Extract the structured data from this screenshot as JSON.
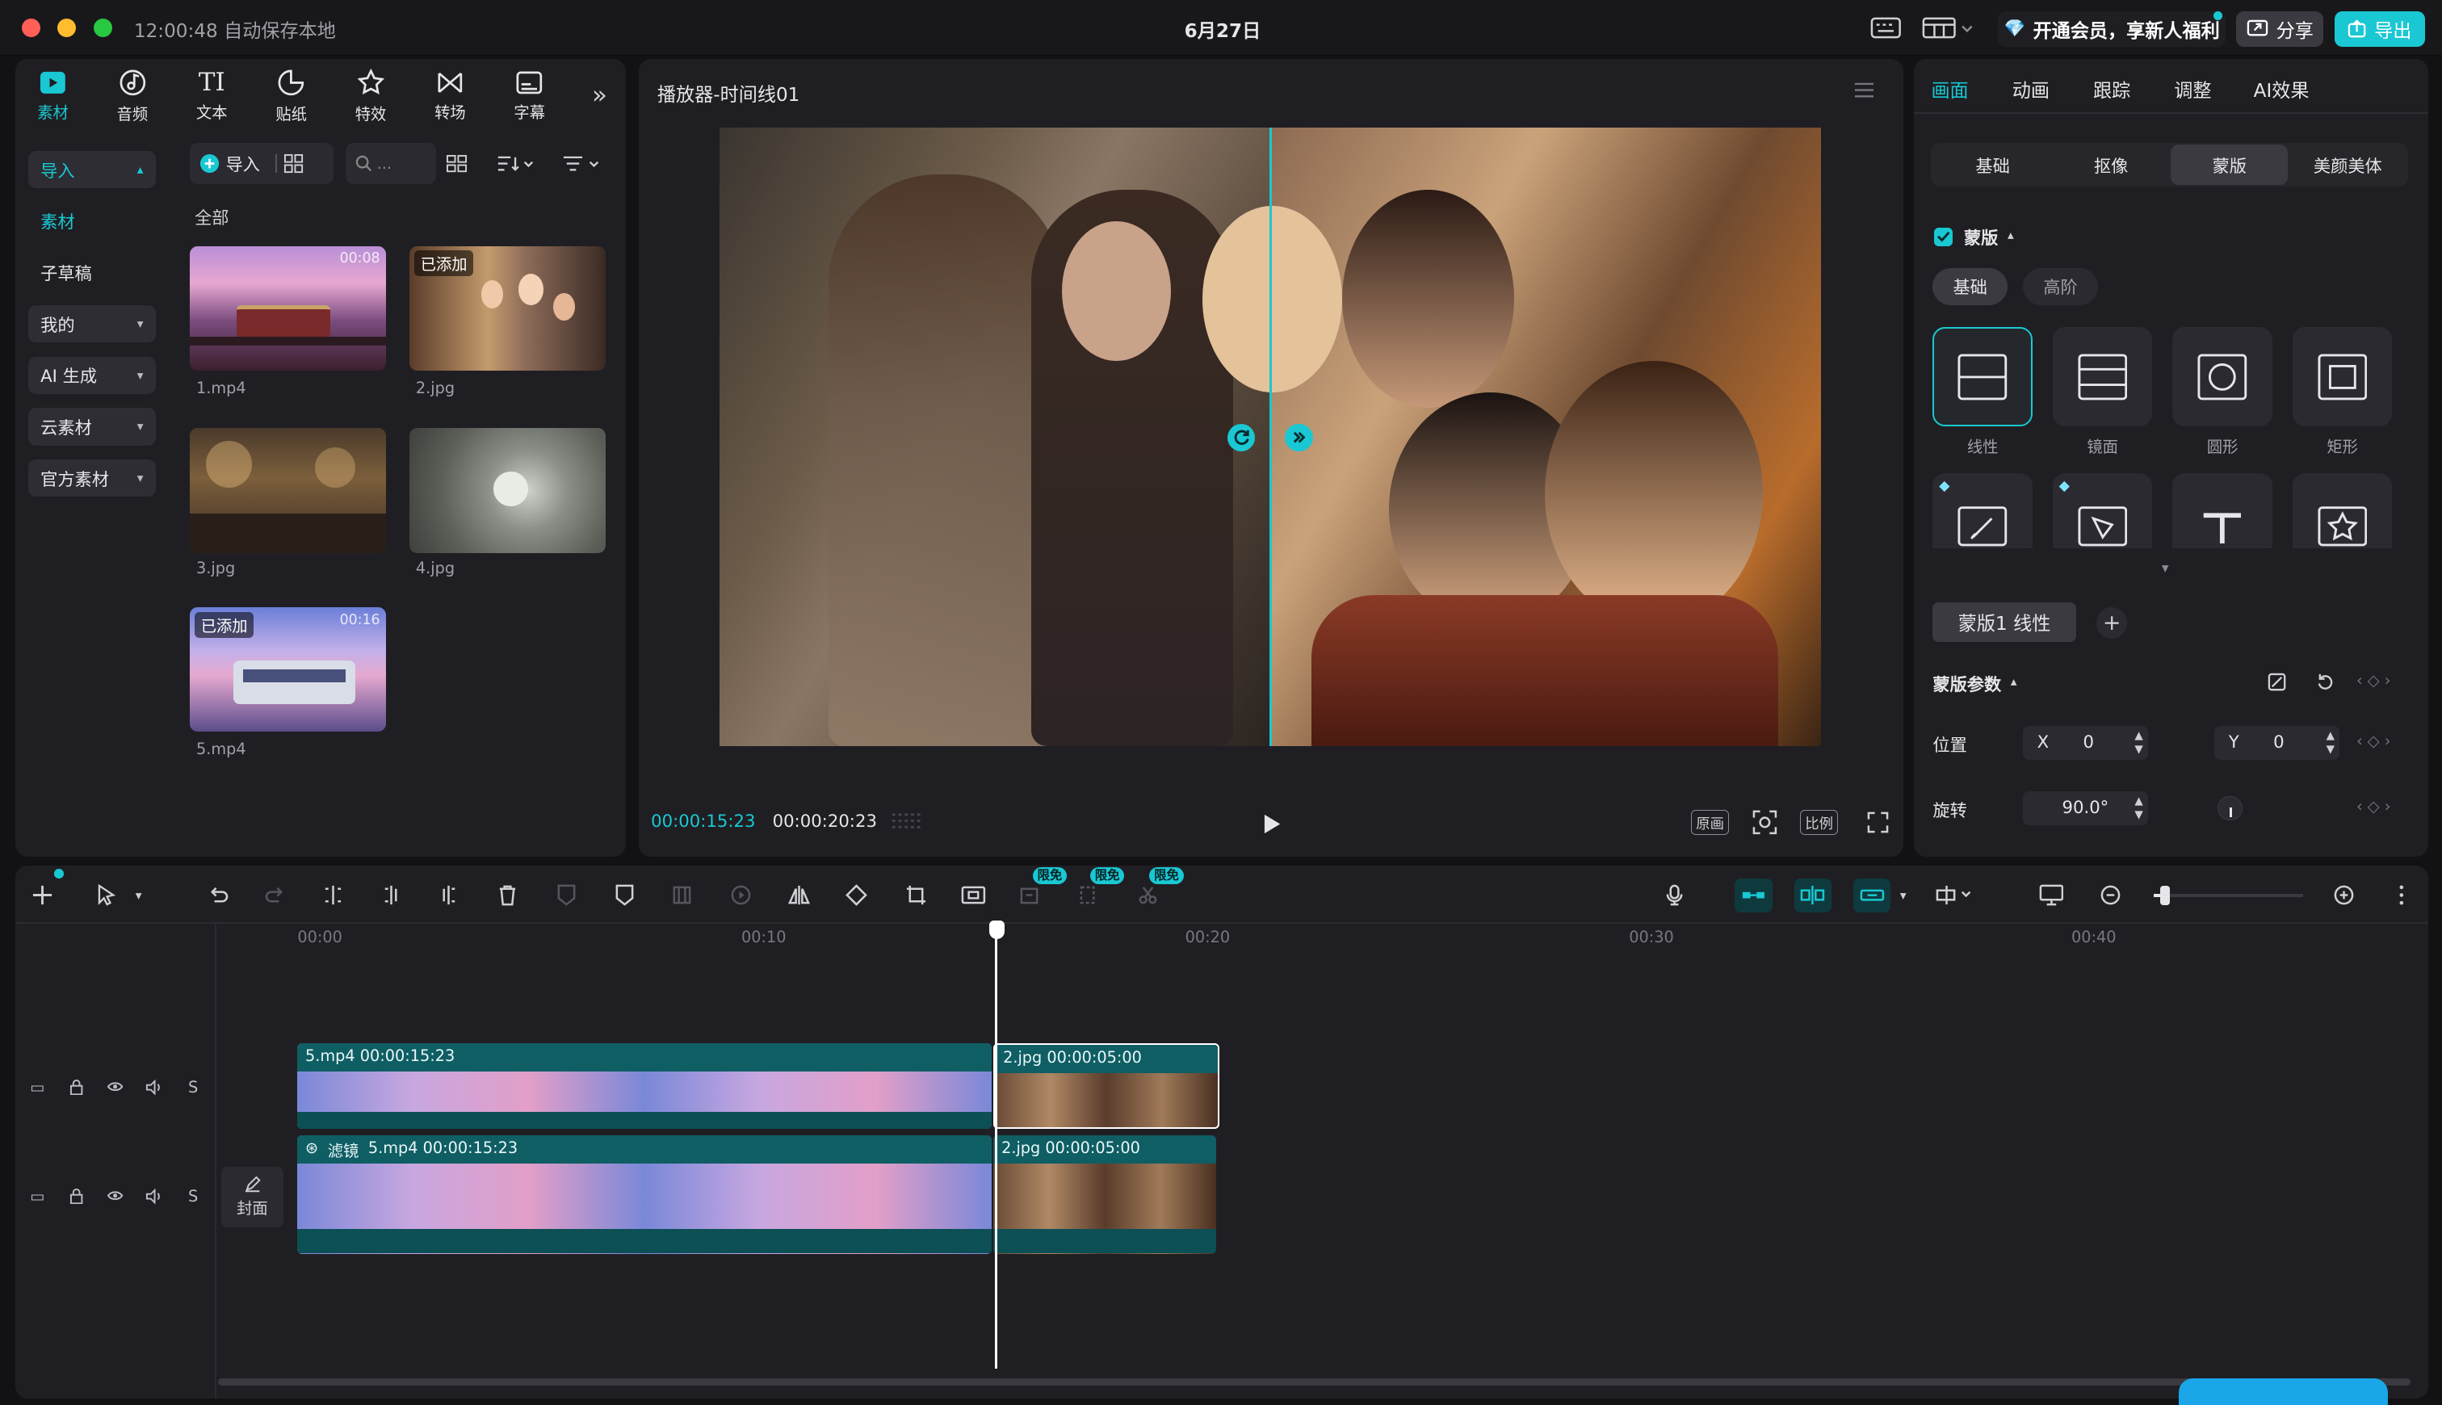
{
  "titlebar": {
    "autosave": "12:00:48 自动保存本地",
    "date": "6月27日",
    "vip_label": "开通会员，享新人福利",
    "share_label": "分享",
    "export_label": "导出"
  },
  "media": {
    "tools": [
      {
        "label": "素材",
        "icon": "media-icon"
      },
      {
        "label": "音频",
        "icon": "audio-icon"
      },
      {
        "label": "文本",
        "icon": "text-icon"
      },
      {
        "label": "贴纸",
        "icon": "sticker-icon"
      },
      {
        "label": "特效",
        "icon": "effects-icon"
      },
      {
        "label": "转场",
        "icon": "transition-icon"
      },
      {
        "label": "字幕",
        "icon": "subtitle-icon"
      }
    ],
    "sidebar": [
      {
        "label": "导入"
      },
      {
        "label": "素材"
      },
      {
        "label": "子草稿"
      },
      {
        "label": "我的"
      },
      {
        "label": "AI 生成"
      },
      {
        "label": "云素材"
      },
      {
        "label": "官方素材"
      }
    ],
    "import_label": "导入",
    "search_placeholder": "...",
    "all_label": "全部",
    "items": [
      {
        "name": "1.mp4",
        "duration": "00:08",
        "badge": ""
      },
      {
        "name": "2.jpg",
        "duration": "",
        "badge": "已添加"
      },
      {
        "name": "3.jpg",
        "duration": "",
        "badge": ""
      },
      {
        "name": "4.jpg",
        "duration": "",
        "badge": ""
      },
      {
        "name": "5.mp4",
        "duration": "00:16",
        "badge": "已添加"
      }
    ]
  },
  "player": {
    "title": "播放器-时间线01",
    "current_time": "00:00:15:23",
    "total_time": "00:00:20:23",
    "btn_original": "原画",
    "btn_ratio": "比例"
  },
  "inspector": {
    "tabs": [
      "画面",
      "动画",
      "跟踪",
      "调整",
      "AI效果"
    ],
    "subtabs": [
      "基础",
      "抠像",
      "蒙版",
      "美颜美体"
    ],
    "mask_section": "蒙版",
    "mask_modes": [
      "基础",
      "高阶"
    ],
    "masks": [
      {
        "label": "线性"
      },
      {
        "label": "镜面"
      },
      {
        "label": "圆形"
      },
      {
        "label": "矩形"
      }
    ],
    "mask_chip": "蒙版1 线性",
    "params_title": "蒙版参数",
    "position_label": "位置",
    "x_label": "X",
    "x_value": "0",
    "y_label": "Y",
    "y_value": "0",
    "rotation_label": "旋转",
    "rotation_value": "90.0°"
  },
  "timeline": {
    "free_tag": "限免",
    "ruler": [
      "00:00",
      "00:10",
      "00:20",
      "00:30",
      "00:40"
    ],
    "clips": {
      "top_a": "5.mp4   00:00:15:23",
      "top_b": "2.jpg   00:00:05:00",
      "main_a_filter": "滤镜",
      "main_a": "5.mp4   00:00:15:23",
      "main_b": "2.jpg   00:00:05:00"
    },
    "cover_label": "封面",
    "track_s": "S"
  },
  "colors": {
    "accent": "#19c8d2",
    "clip_teal": "#0f5e64"
  }
}
